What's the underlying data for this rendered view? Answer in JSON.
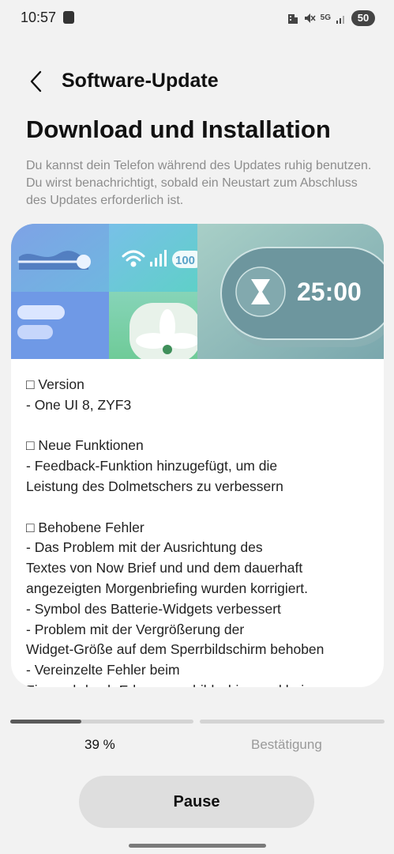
{
  "status_bar": {
    "time": "10:57",
    "network": "5G",
    "battery": "50",
    "icons": [
      "app-notification-icon",
      "building-icon",
      "mute-icon",
      "network-5g-icon",
      "signal-icon",
      "battery-icon"
    ]
  },
  "header": {
    "back_icon": "chevron-left-icon",
    "title": "Software-Update"
  },
  "page": {
    "heading": "Download und Installation",
    "description": "Du kannst dein Telefon während des Updates ruhig benutzen. Du wirst benachrichtigt, sobald ein Neustart zum Abschluss des Updates erforderlich ist."
  },
  "banner": {
    "battery_text": "100",
    "timer_text": "25:00",
    "icons": [
      "wave-slider-icon",
      "wifi-icon",
      "signal-bars-icon",
      "hourglass-icon",
      "fan-icon"
    ]
  },
  "notes": {
    "lines": [
      "□ Version",
      "- One UI 8, ZYF3",
      "",
      "□ Neue Funktionen",
      "- Feedback-Funktion hinzugefügt, um die",
      "Leistung des Dolmetschers zu verbessern",
      "",
      "□ Behobene Fehler",
      "- Das Problem mit der Ausrichtung des",
      "Textes von Now Brief und und dem dauerhaft",
      "angezeigten Morgenbriefing wurden korrigiert.",
      "- Symbol des Batterie-Widgets verbessert",
      "- Problem mit der Vergrößerung der",
      "Widget-Größe auf dem Sperrbildschirm behoben",
      "- Vereinzelte Fehler beim",
      "Fingerabdruck-Erkennungsbildschirm und bei"
    ]
  },
  "progress": {
    "percent": 39,
    "percent_label": "39 %",
    "next_step_label": "Bestätigung",
    "colors": {
      "fill": "#5a5a5a",
      "track": "#d4d4d4"
    }
  },
  "actions": {
    "pause_label": "Pause"
  }
}
